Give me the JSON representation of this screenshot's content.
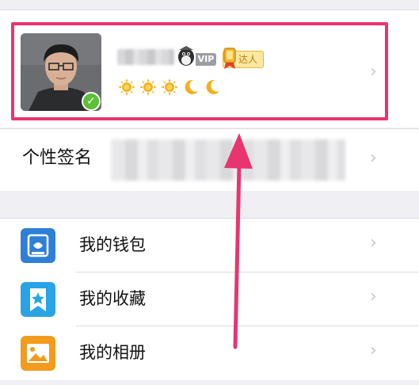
{
  "profile": {
    "vip_label": "VIP",
    "talent_label": "达人",
    "level_icons": [
      "sun-icon",
      "sun-icon",
      "sun-icon",
      "moon-icon",
      "moon-icon"
    ],
    "verified": true
  },
  "signature": {
    "label": "个性签名"
  },
  "menu": {
    "items": [
      {
        "label": "我的钱包",
        "icon": "wallet-icon",
        "color": "#2f7fd6"
      },
      {
        "label": "我的收藏",
        "icon": "favorites-icon",
        "color": "#2aa3e6"
      },
      {
        "label": "我的相册",
        "icon": "album-icon",
        "color": "#f29b1d"
      }
    ]
  },
  "colors": {
    "highlight": "#e8356f",
    "background": "#f0eff4",
    "chevron": "#c7c7cc"
  }
}
